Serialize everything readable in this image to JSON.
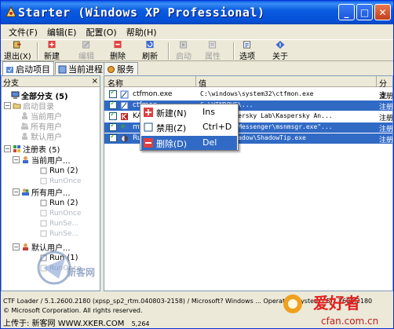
{
  "window": {
    "title": "Starter (Windows XP Professional)",
    "accent": "#0a5ee6",
    "selection_color": "#316ac5"
  },
  "menu": [
    "文件(F)",
    "编辑(E)",
    "配置(O)",
    "帮助(H)"
  ],
  "toolbar": {
    "exit": "退出(X)",
    "new": "新建",
    "edit": "编辑",
    "delete": "删除",
    "refresh": "刷新",
    "start": "启动",
    "properties": "属性",
    "options": "选项",
    "about": "关于"
  },
  "tabs": [
    "启动项目",
    "当前进程",
    "服务"
  ],
  "left": {
    "header": "分支",
    "close": "×",
    "tree": [
      {
        "label": "全部分支 (5)",
        "style": "bold"
      },
      {
        "label": "启动目录",
        "style": "grey"
      },
      {
        "label": "当前用户",
        "style": "grey"
      },
      {
        "label": "所有用户",
        "style": "grey"
      },
      {
        "label": "默认用户",
        "style": "grey"
      },
      {
        "label": "注册表 (5)",
        "style": "normal"
      },
      {
        "label": "当前用户...",
        "style": "normal"
      },
      {
        "label": "Run (2)",
        "style": "normal"
      },
      {
        "label": "RunOnce",
        "style": "faint"
      },
      {
        "label": "所有用户...",
        "style": "normal"
      },
      {
        "label": "Run (2)",
        "style": "normal"
      },
      {
        "label": "RunOnce",
        "style": "faint"
      },
      {
        "label": "RunSe...",
        "style": "faint"
      },
      {
        "label": "RunSe...",
        "style": "faint"
      },
      {
        "label": "默认用户...",
        "style": "normal"
      },
      {
        "label": "Run (1)",
        "style": "normal"
      },
      {
        "label": "RunOnce",
        "style": "faint"
      }
    ]
  },
  "list": {
    "columns": [
      "名称",
      "值",
      "分支"
    ],
    "rows": [
      {
        "name": "ctfmon.exe",
        "path": "C:\\windows\\system32\\ctfmon.exe",
        "cat": "注册",
        "selected": false,
        "icon": "ctfmon-icon"
      },
      {
        "name": "ctfmon",
        "path": "C:\\WINDOWS\\...",
        "cat": "注册",
        "selected": true,
        "icon": "ctfmon-icon"
      },
      {
        "name": "KA",
        "path": "Files\\Kaspersky Lab\\Kaspersky An...",
        "cat": "注册",
        "selected": false,
        "icon": "kaspersky-icon"
      },
      {
        "name": "msn",
        "path": "Files\\MSN Messenger\\msnmsgr.exe\"...",
        "cat": "注册",
        "selected": true,
        "icon": "msn-icon"
      },
      {
        "name": "Ru",
        "path": "ystem32\\shadow\\ShadowTip.exe",
        "cat": "注册",
        "selected": true,
        "icon": "shadow-icon"
      }
    ]
  },
  "context_menu": [
    {
      "label": "新建(N)",
      "key": "Ins",
      "icon": "new-icon",
      "highlighted": false
    },
    {
      "label": "禁用(Z)",
      "key": "Ctrl+D",
      "icon": "checkbox-icon",
      "highlighted": false
    },
    {
      "label": "删除(D)",
      "key": "Del",
      "icon": "delete-icon",
      "highlighted": true
    }
  ],
  "status": {
    "line1": "CTF Loader / 5.1.2600.2180 (xpsp_sp2_rtm.040803-2158) / Microsoft? Windows ... Operating System / 5.1.2600.2180",
    "line2": "© Microsoft Corporation. All rights reserved.",
    "line3": "上传于: 新客网 WWW.XKER.COM",
    "size": "5,264"
  },
  "watermark": {
    "left": "新客网",
    "right_brand": "爱好者",
    "right_url": "cfan.com.cn"
  }
}
